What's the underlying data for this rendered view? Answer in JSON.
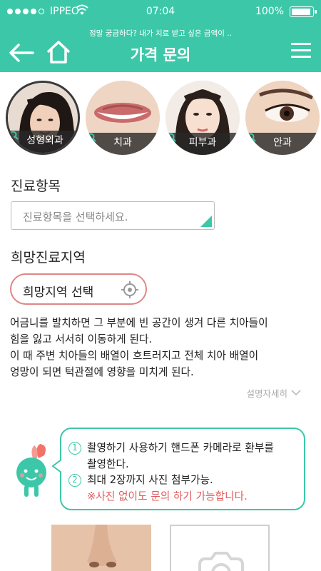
{
  "status_bar": {
    "carrier": "IPPEO",
    "time": "07:04",
    "battery": "100%"
  },
  "header": {
    "subtitle": "정말 궁금하다? 내가 치료 받고 싶은 금액이 ..",
    "title": "가격 문의"
  },
  "categories": [
    {
      "label": "성형외과",
      "icon": "search-icon"
    },
    {
      "label": "치과",
      "icon": "search-icon"
    },
    {
      "label": "피부과",
      "icon": "search-icon"
    },
    {
      "label": "안과",
      "icon": "search-icon"
    }
  ],
  "treatment": {
    "label": "진료항목",
    "placeholder": "진료항목을 선택하세요."
  },
  "region": {
    "label": "희망진료지역",
    "button": "희망지역 선택"
  },
  "description": {
    "lines": [
      "어금니를 발치하면 그 부분에 빈 공간이 생겨 다른 치아들이",
      "힘을 잃고 서서히 이동하게 된다.",
      "이 때 주변 치아들의 배열이 흐트러지고 전체 치아 배열이",
      "엉망이 되면 턱관절에 영향을 미치게 된다."
    ],
    "more": "설명자세히"
  },
  "info": {
    "n1": "1",
    "line1": "촬영하기 사용하기 핸드폰 카메라로 환부를",
    "line1b": "촬영한다.",
    "n2": "2",
    "line2": "최대 2장까지 사진  첨부가능.",
    "note": "※사진 없이도 문의 하기 가능합니다."
  },
  "colors": {
    "accent": "#3cc8a8",
    "region_border": "#e08585",
    "note": "#e05a5a"
  }
}
